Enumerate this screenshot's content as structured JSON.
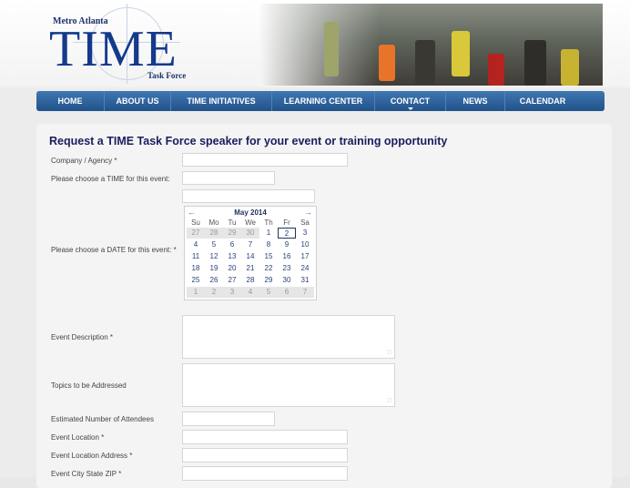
{
  "header": {
    "logo_org": "Metro Atlanta",
    "logo_word": "TIME",
    "logo_tf": "Task Force"
  },
  "nav": {
    "items": [
      {
        "label": "HOME"
      },
      {
        "label": "ABOUT US"
      },
      {
        "label": "TIME INITIATIVES"
      },
      {
        "label": "LEARNING CENTER"
      },
      {
        "label": "CONTACT"
      },
      {
        "label": "NEWS"
      },
      {
        "label": "CALENDAR"
      }
    ]
  },
  "form": {
    "title": "Request a TIME Task Force speaker for your event or training opportunity",
    "labels": {
      "company": "Company / Agency *",
      "time": "Please choose a TIME for this event:",
      "date": "Please choose a DATE for this event: *",
      "description": "Event Description *",
      "topics": "Topics to be Addressed",
      "attendees": "Estimated Number of Attendees",
      "location": "Event Location *",
      "address": "Event Location Address *",
      "city": "Event City State ZIP *"
    }
  },
  "calendar": {
    "month_label": "May 2014",
    "weekdays": [
      "Su",
      "Mo",
      "Tu",
      "We",
      "Th",
      "Fr",
      "Sa"
    ],
    "weeks": [
      [
        "27",
        "28",
        "29",
        "30",
        "1",
        "2",
        "3"
      ],
      [
        "4",
        "5",
        "6",
        "7",
        "8",
        "9",
        "10"
      ],
      [
        "11",
        "12",
        "13",
        "14",
        "15",
        "16",
        "17"
      ],
      [
        "18",
        "19",
        "20",
        "21",
        "22",
        "23",
        "24"
      ],
      [
        "25",
        "26",
        "27",
        "28",
        "29",
        "30",
        "31"
      ],
      [
        "1",
        "2",
        "3",
        "4",
        "5",
        "6",
        "7"
      ]
    ],
    "selected": "2",
    "other_month_cells": [
      [
        0,
        0
      ],
      [
        0,
        1
      ],
      [
        0,
        2
      ],
      [
        0,
        3
      ],
      [
        5,
        0
      ],
      [
        5,
        1
      ],
      [
        5,
        2
      ],
      [
        5,
        3
      ],
      [
        5,
        4
      ],
      [
        5,
        5
      ],
      [
        5,
        6
      ]
    ]
  }
}
